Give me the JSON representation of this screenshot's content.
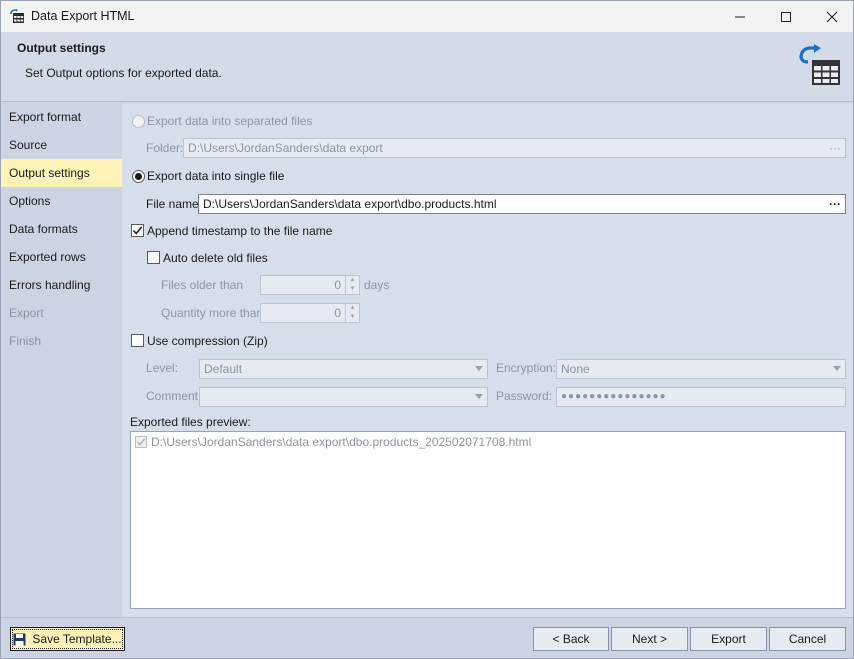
{
  "window": {
    "title": "Data Export HTML",
    "icon": "table-export-icon"
  },
  "header": {
    "title": "Output settings",
    "subtitle": "Set Output options for exported data.",
    "icon": "export-table-icon"
  },
  "sidebar": {
    "items": [
      {
        "label": "Export format",
        "state": "normal"
      },
      {
        "label": "Source",
        "state": "normal"
      },
      {
        "label": "Output settings",
        "state": "active"
      },
      {
        "label": "Options",
        "state": "normal"
      },
      {
        "label": "Data formats",
        "state": "normal"
      },
      {
        "label": "Exported rows",
        "state": "normal"
      },
      {
        "label": "Errors handling",
        "state": "normal"
      },
      {
        "label": "Export",
        "state": "disabled"
      },
      {
        "label": "Finish",
        "state": "disabled"
      }
    ]
  },
  "main": {
    "separate_files": {
      "label": "Export data into separated files",
      "folder_label": "Folder:",
      "folder_value": "D:\\Users\\JordanSanders\\data export"
    },
    "single_file": {
      "label": "Export data into single file",
      "file_name_label": "File name:",
      "file_name_value": "D:\\Users\\JordanSanders\\data export\\dbo.products.html"
    },
    "append_timestamp_label": "Append timestamp to the file name",
    "auto_delete": {
      "label": "Auto delete old files",
      "files_older_label": "Files older than",
      "files_older_value": "0",
      "days_label": "days",
      "quantity_label": "Quantity more than",
      "quantity_value": "0"
    },
    "compression": {
      "label": "Use compression (Zip)",
      "level_label": "Level:",
      "level_value": "Default",
      "encryption_label": "Encryption:",
      "encryption_value": "None",
      "comment_label": "Comment:",
      "comment_value": "",
      "password_label": "Password:",
      "password_value": "●●●●●●●●●●●●●●●"
    },
    "preview": {
      "label": "Exported files preview:",
      "items": [
        "D:\\Users\\JordanSanders\\data export\\dbo.products_202502071708.html"
      ]
    },
    "browse_glyph": "···"
  },
  "footer": {
    "save_template": "Save Template...",
    "back": "< Back",
    "next": "Next >",
    "export": "Export",
    "cancel": "Cancel"
  },
  "colors": {
    "accent_highlight": "#fff3b8",
    "panel": "#d7deeb",
    "sidebar": "#ccd4e3",
    "icon_blue": "#1e6fc9"
  }
}
